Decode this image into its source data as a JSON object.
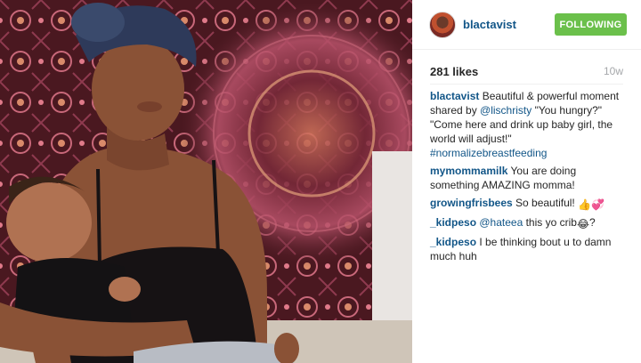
{
  "post": {
    "username": "blactavist",
    "follow_label": "FOLLOWING",
    "likes": "281 likes",
    "age": "10w"
  },
  "caption": {
    "user": "blactavist",
    "text1": " Beautiful & powerful moment shared by ",
    "mention": "@lischristy",
    "text2": " \"You hungry?\" \"Come here and drink up baby girl, the world will adjust!\" ",
    "hashtag": "#normalizebreastfeeding"
  },
  "comments": [
    {
      "user": "mymommamilk",
      "text": " You are doing something AMAZING momma!"
    },
    {
      "user": "growingfrisbees",
      "text": " So beautiful! ",
      "emojis": "👍💞"
    },
    {
      "user": "_kidpeso",
      "mention": "@hateea",
      "text": " this yo crib",
      "emoji": "😂",
      "tail": "?"
    },
    {
      "user": "_kidpeso",
      "text": " I be thinking bout u to damn much huh"
    }
  ],
  "colors": {
    "link": "#125688",
    "follow_bg": "#6bc04b",
    "muted": "#a5a7aa"
  },
  "icons": {
    "avatar": "profile-avatar"
  }
}
